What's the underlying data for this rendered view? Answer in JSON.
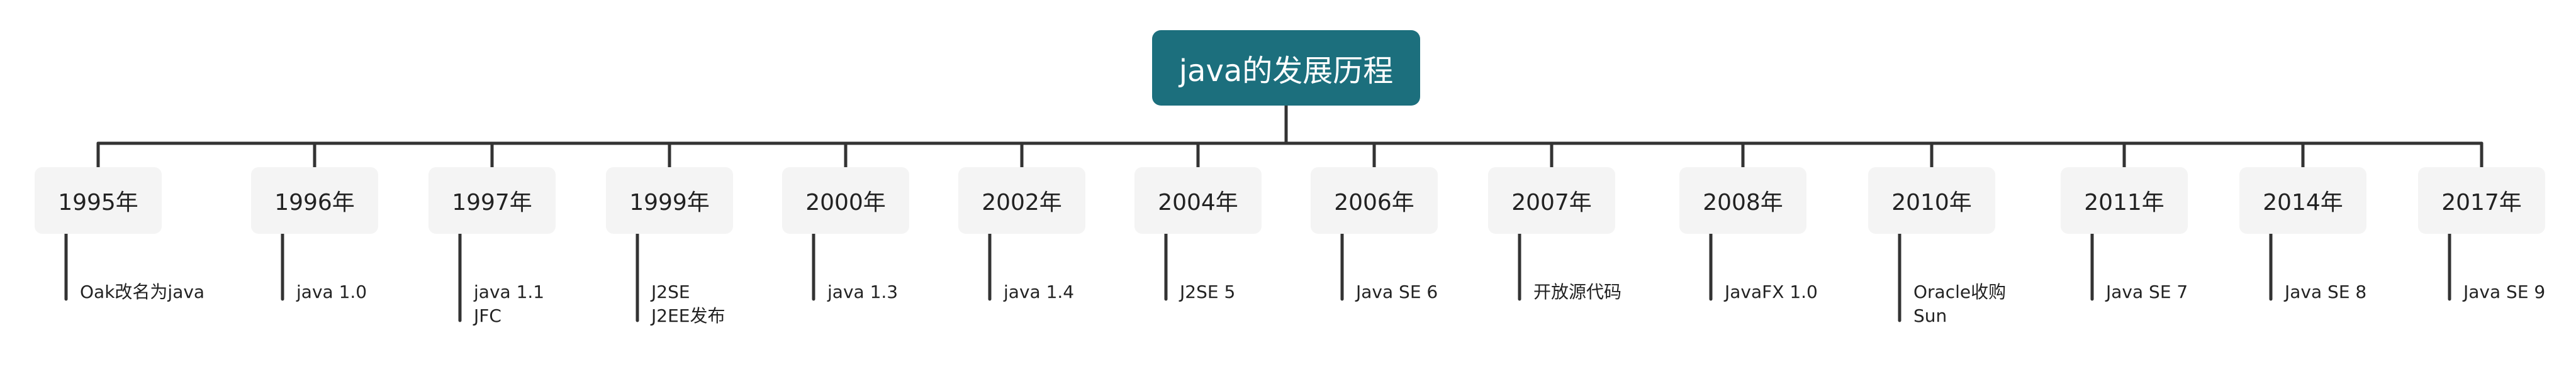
{
  "root": {
    "title": "java的发展历程"
  },
  "colors": {
    "root_background": "#1c6f7d",
    "root_text": "#ffffff",
    "node_background": "#f4f4f4",
    "line": "#333333",
    "text": "#222222"
  },
  "milestones": [
    {
      "year": "1995年",
      "events": [
        "Oak改名为java"
      ]
    },
    {
      "year": "1996年",
      "events": [
        "java 1.0"
      ]
    },
    {
      "year": "1997年",
      "events": [
        "java 1.1",
        "JFC"
      ]
    },
    {
      "year": "1999年",
      "events": [
        "J2SE",
        "J2EE发布"
      ]
    },
    {
      "year": "2000年",
      "events": [
        "java 1.3"
      ]
    },
    {
      "year": "2002年",
      "events": [
        "java 1.4"
      ]
    },
    {
      "year": "2004年",
      "events": [
        "J2SE 5"
      ]
    },
    {
      "year": "2006年",
      "events": [
        "Java SE 6"
      ]
    },
    {
      "year": "2007年",
      "events": [
        "开放源代码"
      ]
    },
    {
      "year": "2008年",
      "events": [
        "JavaFX 1.0"
      ]
    },
    {
      "year": "2010年",
      "events": [
        "Oracle收购",
        "Sun"
      ]
    },
    {
      "year": "2011年",
      "events": [
        "Java SE 7"
      ]
    },
    {
      "year": "2014年",
      "events": [
        "Java SE 8"
      ]
    },
    {
      "year": "2017年",
      "events": [
        "Java SE 9"
      ]
    }
  ]
}
